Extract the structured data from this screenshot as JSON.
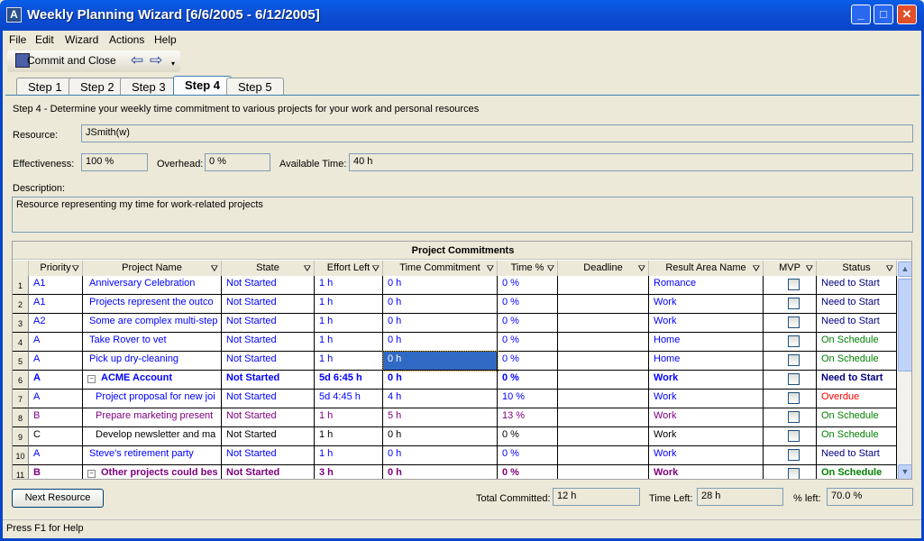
{
  "window": {
    "title": "Weekly Planning Wizard [6/6/2005 - 6/12/2005]"
  },
  "menu": [
    "File",
    "Edit",
    "Wizard",
    "Actions",
    "Help"
  ],
  "toolbar": {
    "commit_label": "Commit and Close"
  },
  "tabs": [
    "Step 1",
    "Step 2",
    "Step 3",
    "Step 4",
    "Step 5"
  ],
  "active_tab": "Step 4",
  "step_text": "Step 4 - Determine your weekly time commitment to various projects for your work and personal resources",
  "form": {
    "resource_label": "Resource:",
    "resource": "JSmith(w)",
    "effectiveness_label": "Effectiveness:",
    "effectiveness": "100 %",
    "overhead_label": "Overhead:",
    "overhead": "0 %",
    "available_label": "Available Time:",
    "available": "40 h",
    "description_label": "Description:",
    "description": "Resource representing my time for work-related projects"
  },
  "grid": {
    "title": "Project Commitments",
    "columns": [
      "Priority",
      "Project Name",
      "State",
      "Effort Left",
      "Time Commitment",
      "Time %",
      "Deadline",
      "Result Area Name",
      "MVP",
      "Status"
    ],
    "rows": [
      {
        "n": "1",
        "priority": "A1",
        "name": "Anniversary Celebration",
        "state": "Not Started",
        "effort": "1 h",
        "commit": "0 h",
        "pct": "0 %",
        "deadline": "",
        "area": "Romance",
        "mvp": false,
        "status": "Need to Start",
        "color": "blue",
        "status_color": "navy"
      },
      {
        "n": "2",
        "priority": "A1",
        "name": "Projects represent the outco",
        "state": "Not Started",
        "effort": "1 h",
        "commit": "0 h",
        "pct": "0 %",
        "deadline": "",
        "area": "Work",
        "mvp": false,
        "status": "Need to Start",
        "color": "blue",
        "status_color": "navy"
      },
      {
        "n": "3",
        "priority": "A2",
        "name": "Some are complex multi-step",
        "state": "Not Started",
        "effort": "1 h",
        "commit": "0 h",
        "pct": "0 %",
        "deadline": "",
        "area": "Work",
        "mvp": false,
        "status": "Need to Start",
        "color": "blue",
        "status_color": "navy"
      },
      {
        "n": "4",
        "priority": "A",
        "name": "Take Rover to vet",
        "state": "Not Started",
        "effort": "1 h",
        "commit": "0 h",
        "pct": "0 %",
        "deadline": "",
        "area": "Home",
        "mvp": false,
        "status": "On Schedule",
        "color": "blue",
        "status_color": "green"
      },
      {
        "n": "5",
        "priority": "A",
        "name": "Pick up dry-cleaning",
        "state": "Not Started",
        "effort": "1 h",
        "commit": "0 h",
        "pct": "0 %",
        "deadline": "",
        "area": "Home",
        "mvp": false,
        "status": "On Schedule",
        "color": "blue",
        "status_color": "green",
        "selected": true
      },
      {
        "n": "6",
        "priority": "A",
        "name": "ACME Account",
        "state": "Not Started",
        "effort": "5d 6:45 h",
        "commit": "0 h",
        "pct": "0 %",
        "deadline": "",
        "area": "Work",
        "mvp": false,
        "status": "Need to Start",
        "color": "blue",
        "status_color": "navy",
        "group": true
      },
      {
        "n": "7",
        "priority": "A",
        "name": "Project proposal for new joi",
        "state": "Not Started",
        "effort": "5d 4:45 h",
        "commit": "4 h",
        "pct": "10 %",
        "deadline": "",
        "area": "Work",
        "mvp": false,
        "status": "Overdue",
        "color": "blue",
        "status_color": "red",
        "child": true
      },
      {
        "n": "8",
        "priority": "B",
        "name": "Prepare marketing present",
        "state": "Not Started",
        "effort": "1 h",
        "commit": "5 h",
        "pct": "13 %",
        "deadline": "",
        "area": "Work",
        "mvp": false,
        "status": "On Schedule",
        "color": "purple",
        "status_color": "green",
        "child": true
      },
      {
        "n": "9",
        "priority": "C",
        "name": "Develop newsletter and ma",
        "state": "Not Started",
        "effort": "1 h",
        "commit": "0 h",
        "pct": "0 %",
        "deadline": "",
        "area": "Work",
        "mvp": false,
        "status": "On Schedule",
        "color": "black",
        "status_color": "green",
        "child": true
      },
      {
        "n": "10",
        "priority": "A",
        "name": "Steve's retirement party",
        "state": "Not Started",
        "effort": "1 h",
        "commit": "0 h",
        "pct": "0 %",
        "deadline": "",
        "area": "Work",
        "mvp": false,
        "status": "Need to Start",
        "color": "blue",
        "status_color": "navy"
      },
      {
        "n": "11",
        "priority": "B",
        "name": "Other projects could bes",
        "state": "Not Started",
        "effort": "3 h",
        "commit": "0 h",
        "pct": "0 %",
        "deadline": "",
        "area": "Work",
        "mvp": false,
        "status": "On Schedule",
        "color": "purple",
        "status_color": "green",
        "group": true
      }
    ]
  },
  "footer": {
    "next_label": "Next Resource",
    "total_label": "Total Committed:",
    "total": "12 h",
    "left_label": "Time Left:",
    "left": "28 h",
    "pct_label": "% left:",
    "pct": "70.0 %"
  },
  "statusbar": "Press F1 for Help",
  "colors": {
    "blue": "#0000ff",
    "purple": "#800080",
    "black": "#000000",
    "navy": "#000080",
    "green": "#008000",
    "red": "#ff0000"
  }
}
